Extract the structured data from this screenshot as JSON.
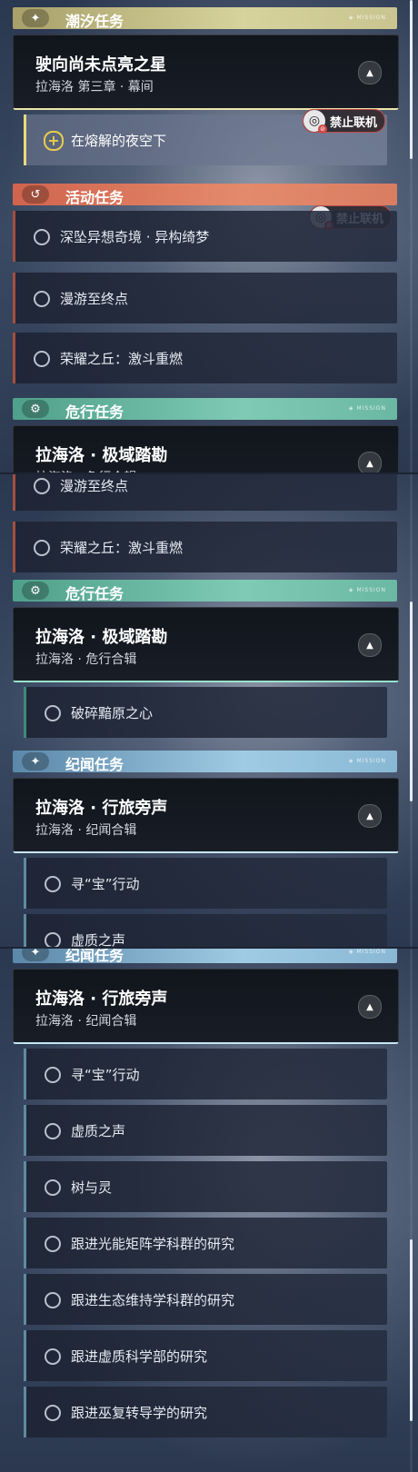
{
  "sections": {
    "tide": "潮汐任务",
    "event": "活动任务",
    "danger": "危行任务",
    "lore": "纪闻任务",
    "tag": "◈ MISSION"
  },
  "badge_icons": {
    "tide": "sparkle-icon",
    "event": "refresh-icon",
    "danger": "gear-icon",
    "lore": "sparkle-icon"
  },
  "offline_label": "禁止联机",
  "chapters": {
    "tide": {
      "title": "驶向尚未点亮之星",
      "sub": "拉海洛 第三章 · 幕间"
    },
    "danger": {
      "title": "拉海洛 · 极域踏勘",
      "sub": "拉海洛 · 危行合辑"
    },
    "lore": {
      "title": "拉海洛 · 行旅旁声",
      "sub": "拉海洛 · 纪闻合辑"
    }
  },
  "tasks": {
    "tide_active": "在熔解的夜空下",
    "event": [
      "深坠异想奇境 · 异构绮梦",
      "漫游至终点",
      "荣耀之丘：激斗重燃"
    ],
    "danger": [
      "破碎黯原之心"
    ],
    "lore": [
      "寻“宝”行动",
      "虚质之声",
      "树与灵",
      "跟进光能矩阵学科群的研究",
      "跟进生态维持学科群的研究",
      "跟进虚质科学部的研究",
      "跟进巫复转导学的研究"
    ]
  },
  "colors": {
    "tide": "#d7d39c",
    "event": "#e48a6c",
    "danger": "#7fcab4",
    "lore": "#9fcbe4"
  }
}
